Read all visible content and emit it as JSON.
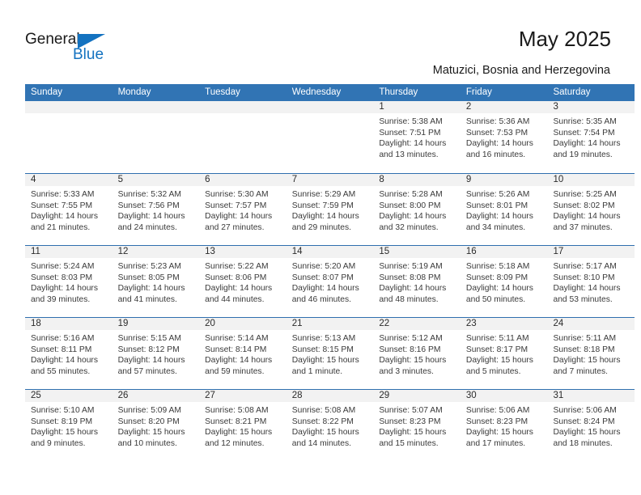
{
  "brand": {
    "name_part1": "General",
    "name_part2": "Blue",
    "triangle_icon": "blue-triangle-logo-icon",
    "accent_color": "#1372c0"
  },
  "header": {
    "month_title": "May 2025",
    "location": "Matuzici, Bosnia and Herzegovina"
  },
  "colors": {
    "header_bar": "#3174b4",
    "day_number_band": "#f2f2f2",
    "week_divider": "#2f6fae",
    "text": "#3a3a3a"
  },
  "weekday_headers": [
    "Sunday",
    "Monday",
    "Tuesday",
    "Wednesday",
    "Thursday",
    "Friday",
    "Saturday"
  ],
  "weeks": [
    [
      {
        "day": "",
        "lines": []
      },
      {
        "day": "",
        "lines": []
      },
      {
        "day": "",
        "lines": []
      },
      {
        "day": "",
        "lines": []
      },
      {
        "day": "1",
        "lines": [
          "Sunrise: 5:38 AM",
          "Sunset: 7:51 PM",
          "Daylight: 14 hours",
          "and 13 minutes."
        ]
      },
      {
        "day": "2",
        "lines": [
          "Sunrise: 5:36 AM",
          "Sunset: 7:53 PM",
          "Daylight: 14 hours",
          "and 16 minutes."
        ]
      },
      {
        "day": "3",
        "lines": [
          "Sunrise: 5:35 AM",
          "Sunset: 7:54 PM",
          "Daylight: 14 hours",
          "and 19 minutes."
        ]
      }
    ],
    [
      {
        "day": "4",
        "lines": [
          "Sunrise: 5:33 AM",
          "Sunset: 7:55 PM",
          "Daylight: 14 hours",
          "and 21 minutes."
        ]
      },
      {
        "day": "5",
        "lines": [
          "Sunrise: 5:32 AM",
          "Sunset: 7:56 PM",
          "Daylight: 14 hours",
          "and 24 minutes."
        ]
      },
      {
        "day": "6",
        "lines": [
          "Sunrise: 5:30 AM",
          "Sunset: 7:57 PM",
          "Daylight: 14 hours",
          "and 27 minutes."
        ]
      },
      {
        "day": "7",
        "lines": [
          "Sunrise: 5:29 AM",
          "Sunset: 7:59 PM",
          "Daylight: 14 hours",
          "and 29 minutes."
        ]
      },
      {
        "day": "8",
        "lines": [
          "Sunrise: 5:28 AM",
          "Sunset: 8:00 PM",
          "Daylight: 14 hours",
          "and 32 minutes."
        ]
      },
      {
        "day": "9",
        "lines": [
          "Sunrise: 5:26 AM",
          "Sunset: 8:01 PM",
          "Daylight: 14 hours",
          "and 34 minutes."
        ]
      },
      {
        "day": "10",
        "lines": [
          "Sunrise: 5:25 AM",
          "Sunset: 8:02 PM",
          "Daylight: 14 hours",
          "and 37 minutes."
        ]
      }
    ],
    [
      {
        "day": "11",
        "lines": [
          "Sunrise: 5:24 AM",
          "Sunset: 8:03 PM",
          "Daylight: 14 hours",
          "and 39 minutes."
        ]
      },
      {
        "day": "12",
        "lines": [
          "Sunrise: 5:23 AM",
          "Sunset: 8:05 PM",
          "Daylight: 14 hours",
          "and 41 minutes."
        ]
      },
      {
        "day": "13",
        "lines": [
          "Sunrise: 5:22 AM",
          "Sunset: 8:06 PM",
          "Daylight: 14 hours",
          "and 44 minutes."
        ]
      },
      {
        "day": "14",
        "lines": [
          "Sunrise: 5:20 AM",
          "Sunset: 8:07 PM",
          "Daylight: 14 hours",
          "and 46 minutes."
        ]
      },
      {
        "day": "15",
        "lines": [
          "Sunrise: 5:19 AM",
          "Sunset: 8:08 PM",
          "Daylight: 14 hours",
          "and 48 minutes."
        ]
      },
      {
        "day": "16",
        "lines": [
          "Sunrise: 5:18 AM",
          "Sunset: 8:09 PM",
          "Daylight: 14 hours",
          "and 50 minutes."
        ]
      },
      {
        "day": "17",
        "lines": [
          "Sunrise: 5:17 AM",
          "Sunset: 8:10 PM",
          "Daylight: 14 hours",
          "and 53 minutes."
        ]
      }
    ],
    [
      {
        "day": "18",
        "lines": [
          "Sunrise: 5:16 AM",
          "Sunset: 8:11 PM",
          "Daylight: 14 hours",
          "and 55 minutes."
        ]
      },
      {
        "day": "19",
        "lines": [
          "Sunrise: 5:15 AM",
          "Sunset: 8:12 PM",
          "Daylight: 14 hours",
          "and 57 minutes."
        ]
      },
      {
        "day": "20",
        "lines": [
          "Sunrise: 5:14 AM",
          "Sunset: 8:14 PM",
          "Daylight: 14 hours",
          "and 59 minutes."
        ]
      },
      {
        "day": "21",
        "lines": [
          "Sunrise: 5:13 AM",
          "Sunset: 8:15 PM",
          "Daylight: 15 hours",
          "and 1 minute."
        ]
      },
      {
        "day": "22",
        "lines": [
          "Sunrise: 5:12 AM",
          "Sunset: 8:16 PM",
          "Daylight: 15 hours",
          "and 3 minutes."
        ]
      },
      {
        "day": "23",
        "lines": [
          "Sunrise: 5:11 AM",
          "Sunset: 8:17 PM",
          "Daylight: 15 hours",
          "and 5 minutes."
        ]
      },
      {
        "day": "24",
        "lines": [
          "Sunrise: 5:11 AM",
          "Sunset: 8:18 PM",
          "Daylight: 15 hours",
          "and 7 minutes."
        ]
      }
    ],
    [
      {
        "day": "25",
        "lines": [
          "Sunrise: 5:10 AM",
          "Sunset: 8:19 PM",
          "Daylight: 15 hours",
          "and 9 minutes."
        ]
      },
      {
        "day": "26",
        "lines": [
          "Sunrise: 5:09 AM",
          "Sunset: 8:20 PM",
          "Daylight: 15 hours",
          "and 10 minutes."
        ]
      },
      {
        "day": "27",
        "lines": [
          "Sunrise: 5:08 AM",
          "Sunset: 8:21 PM",
          "Daylight: 15 hours",
          "and 12 minutes."
        ]
      },
      {
        "day": "28",
        "lines": [
          "Sunrise: 5:08 AM",
          "Sunset: 8:22 PM",
          "Daylight: 15 hours",
          "and 14 minutes."
        ]
      },
      {
        "day": "29",
        "lines": [
          "Sunrise: 5:07 AM",
          "Sunset: 8:23 PM",
          "Daylight: 15 hours",
          "and 15 minutes."
        ]
      },
      {
        "day": "30",
        "lines": [
          "Sunrise: 5:06 AM",
          "Sunset: 8:23 PM",
          "Daylight: 15 hours",
          "and 17 minutes."
        ]
      },
      {
        "day": "31",
        "lines": [
          "Sunrise: 5:06 AM",
          "Sunset: 8:24 PM",
          "Daylight: 15 hours",
          "and 18 minutes."
        ]
      }
    ]
  ]
}
